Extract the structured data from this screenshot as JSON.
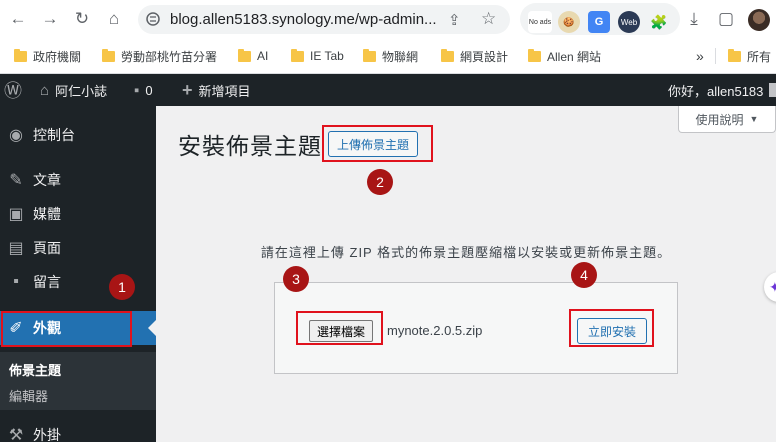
{
  "browser": {
    "url": "blog.allen5183.synology.me/wp-admin...",
    "back_glyph": "←",
    "forward_glyph": "→",
    "reload_glyph": "↻",
    "home_glyph": "⌂",
    "share_glyph": "⇪",
    "star_glyph": "☆",
    "download_glyph": "⤓",
    "sidepanel_glyph": "▢",
    "extensions": [
      {
        "name": "No ads",
        "label": "No ads"
      },
      {
        "name": "cookie",
        "label": "🍪"
      },
      {
        "name": "google-translate",
        "label": "G"
      },
      {
        "name": "web",
        "label": "Web"
      },
      {
        "name": "puzzle",
        "label": "🧩"
      }
    ]
  },
  "bookmarks": {
    "items": [
      "政府機關",
      "勞動部桃竹苗分署",
      "AI",
      "IE Tab",
      "物聯網",
      "網頁設計",
      "Allen 網站"
    ],
    "overflow": "»",
    "other": "所有"
  },
  "adminbar": {
    "site_name": "阿仁小誌",
    "comment_count": "0",
    "new_content": "新增項目",
    "greeting": "你好，allen5183",
    "wp_glyph": "Ⓦ",
    "home_glyph": "⌂",
    "comment_glyph": "▪",
    "plus_glyph": "+"
  },
  "sidebar": {
    "items": [
      {
        "label": "控制台",
        "icon": "◉"
      },
      {
        "label": "文章",
        "icon": "✎"
      },
      {
        "label": "媒體",
        "icon": "▣"
      },
      {
        "label": "頁面",
        "icon": "▤"
      },
      {
        "label": "留言",
        "icon": "▪"
      },
      {
        "label": "外觀",
        "icon": "✐"
      },
      {
        "label": "外掛",
        "icon": "⚒"
      }
    ],
    "submenu": [
      "佈景主題",
      "編輯器"
    ]
  },
  "main": {
    "help_label": "使用說明",
    "help_caret": "▼",
    "title": "安裝佈景主題",
    "upload_label": "上傳佈景主題",
    "instruction": "請在這裡上傳 ZIP 格式的佈景主題壓縮檔以安裝或更新佈景主題。",
    "choose_file_label": "選擇檔案",
    "file_name": "mynote.2.0.5.zip",
    "install_label": "立即安裝",
    "fab_glyph": "✦"
  },
  "annotations": [
    "1",
    "2",
    "3",
    "4"
  ],
  "colors": {
    "admin_dark": "#1d2327",
    "wp_blue": "#2271b1",
    "highlight_red": "#e0121d",
    "badge_red": "#a81515"
  }
}
